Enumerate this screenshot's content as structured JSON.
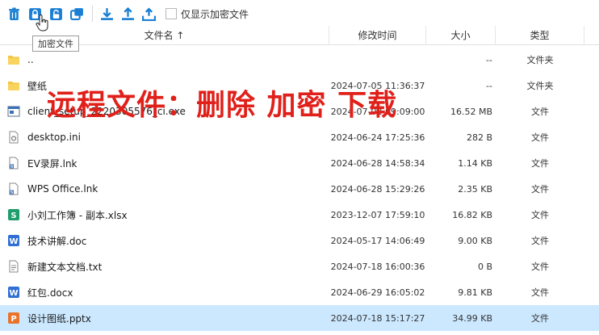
{
  "toolbar": {
    "buttons": [
      {
        "name": "delete-button",
        "icon": "trash-icon"
      },
      {
        "name": "encrypt-button",
        "icon": "lock-icon"
      },
      {
        "name": "decrypt-button",
        "icon": "unlock-icon"
      },
      {
        "name": "copy-button",
        "icon": "copy-icon"
      },
      {
        "name": "download-button",
        "icon": "download-icon"
      },
      {
        "name": "upload-button",
        "icon": "upload-icon"
      },
      {
        "name": "upload-folder-button",
        "icon": "upload-folder-icon"
      }
    ],
    "checkbox_label": "仅显示加密文件"
  },
  "tooltip": "加密文件",
  "columns": {
    "name": "文件名 ↑",
    "date": "修改时间",
    "size": "大小",
    "type": "类型"
  },
  "overlay_text": "远程文件：删除 加密 下载",
  "accent_color": "#1a7fd4",
  "overlay_color": "#e0201a",
  "rows": [
    {
      "icon": "folder-icon",
      "name": "..",
      "date": "",
      "size": "--",
      "type": "文件夹"
    },
    {
      "icon": "folder-icon",
      "name": "壁纸",
      "date": "2024-07-05 11:36:37",
      "size": "--",
      "type": "文件夹"
    },
    {
      "icon": "exe-icon",
      "name": "client_setup_2220305576_ci.exe",
      "date": "2024-07-02 09:09:00",
      "size": "16.52 MB",
      "type": "文件"
    },
    {
      "icon": "ini-icon",
      "name": "desktop.ini",
      "date": "2024-06-24 17:25:36",
      "size": "282 B",
      "type": "文件"
    },
    {
      "icon": "lnk-icon",
      "name": "EV录屏.lnk",
      "date": "2024-06-28 14:58:34",
      "size": "1.14 KB",
      "type": "文件"
    },
    {
      "icon": "lnk-icon",
      "name": "WPS Office.lnk",
      "date": "2024-06-28 15:29:26",
      "size": "2.35 KB",
      "type": "文件"
    },
    {
      "icon": "xlsx-icon",
      "name": "小刘工作簿 - 副本.xlsx",
      "date": "2023-12-07 17:59:10",
      "size": "16.82 KB",
      "type": "文件"
    },
    {
      "icon": "doc-icon",
      "name": "技术讲解.doc",
      "date": "2024-05-17 14:06:49",
      "size": "9.00 KB",
      "type": "文件"
    },
    {
      "icon": "txt-icon",
      "name": "新建文本文档.txt",
      "date": "2024-07-18 16:00:36",
      "size": "0 B",
      "type": "文件"
    },
    {
      "icon": "doc-icon",
      "name": "红包.docx",
      "date": "2024-06-29 16:05:02",
      "size": "9.81 KB",
      "type": "文件"
    },
    {
      "icon": "pptx-icon",
      "name": "设计图纸.pptx",
      "date": "2024-07-18 15:17:27",
      "size": "34.99 KB",
      "type": "文件",
      "selected": true
    }
  ]
}
